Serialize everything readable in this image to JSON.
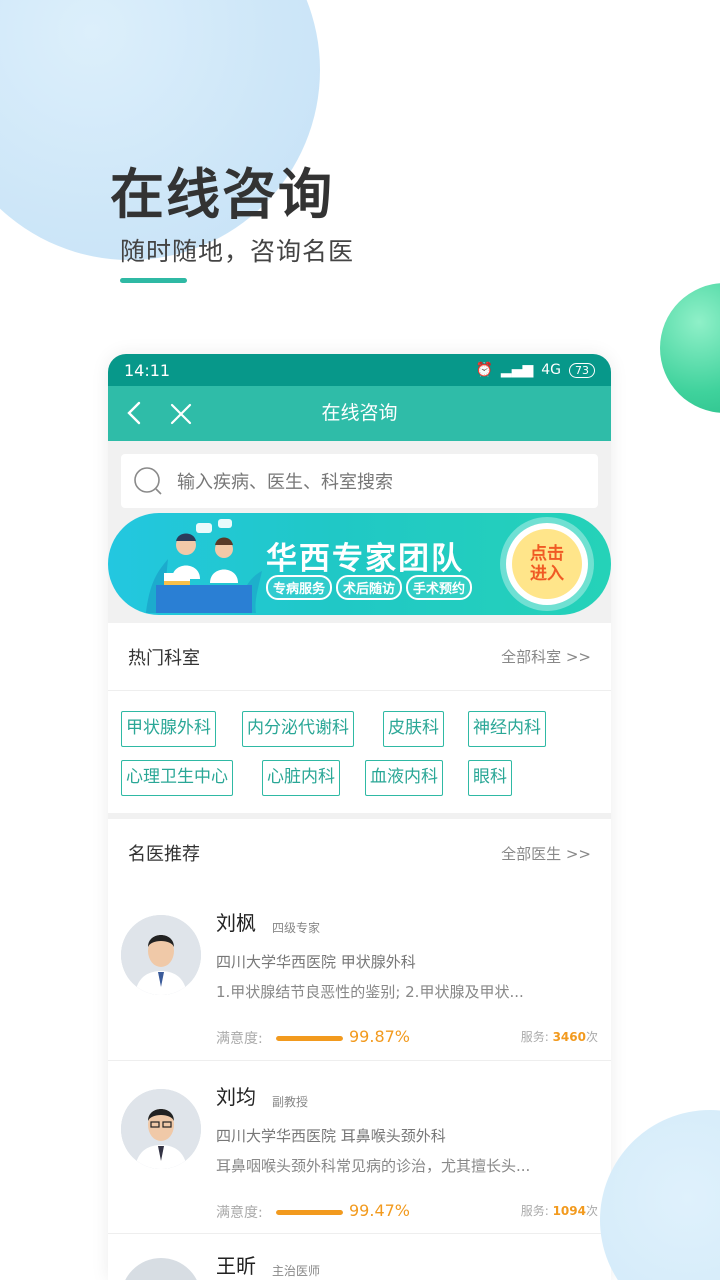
{
  "hero": {
    "title": "在线咨询",
    "subtitle": "随时随地，咨询名医",
    "accent": "#2fb9a4"
  },
  "status_bar": {
    "time": "14:11",
    "network": "4G",
    "battery": "73"
  },
  "navbar": {
    "title": "在线咨询",
    "back_icon": "chevron-left-icon",
    "close_icon": "close-icon",
    "color": "#2fbca8"
  },
  "search": {
    "placeholder": "输入疾病、医生、科室搜索"
  },
  "banner": {
    "title": "华西专家团队",
    "tags": [
      "专病服务",
      "术后随访",
      "手术预约"
    ],
    "button_line1": "点击",
    "button_line2": "进入"
  },
  "departments": {
    "title": "热门科室",
    "more": "全部科室 >>",
    "items": [
      "甲状腺外科",
      "内分泌代谢科",
      "皮肤科",
      "神经内科",
      "心理卫生中心",
      "心脏内科",
      "血液内科",
      "眼科"
    ]
  },
  "doctors": {
    "title": "名医推荐",
    "more": "全部医生 >>",
    "satisfaction_label": "满意度:",
    "service_label": "服务:",
    "service_unit": "次",
    "items": [
      {
        "name": "刘枫",
        "title": "四级专家",
        "hospital": "四川大学华西医院  甲状腺外科",
        "desc": "1.甲状腺结节良恶性的鉴别; 2.甲状腺及甲状...",
        "satisfaction": "99.87%",
        "services": "3460"
      },
      {
        "name": "刘均",
        "title": "副教授",
        "hospital": "四川大学华西医院  耳鼻喉头颈外科",
        "desc": "耳鼻咽喉头颈外科常见病的诊治，尤其擅长头...",
        "satisfaction": "99.47%",
        "services": "1094"
      },
      {
        "name": "王昕",
        "title": "主治医师"
      }
    ]
  }
}
